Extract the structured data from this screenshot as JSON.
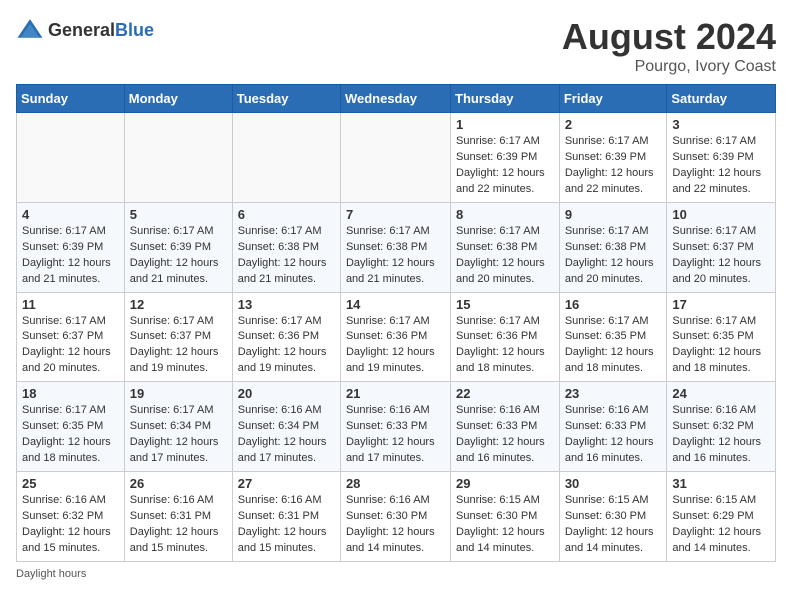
{
  "header": {
    "logo_general": "General",
    "logo_blue": "Blue",
    "month_title": "August 2024",
    "location": "Pourgo, Ivory Coast"
  },
  "days_of_week": [
    "Sunday",
    "Monday",
    "Tuesday",
    "Wednesday",
    "Thursday",
    "Friday",
    "Saturday"
  ],
  "weeks": [
    [
      {
        "day": "",
        "info": ""
      },
      {
        "day": "",
        "info": ""
      },
      {
        "day": "",
        "info": ""
      },
      {
        "day": "",
        "info": ""
      },
      {
        "day": "1",
        "info": "Sunrise: 6:17 AM\nSunset: 6:39 PM\nDaylight: 12 hours\nand 22 minutes."
      },
      {
        "day": "2",
        "info": "Sunrise: 6:17 AM\nSunset: 6:39 PM\nDaylight: 12 hours\nand 22 minutes."
      },
      {
        "day": "3",
        "info": "Sunrise: 6:17 AM\nSunset: 6:39 PM\nDaylight: 12 hours\nand 22 minutes."
      }
    ],
    [
      {
        "day": "4",
        "info": "Sunrise: 6:17 AM\nSunset: 6:39 PM\nDaylight: 12 hours\nand 21 minutes."
      },
      {
        "day": "5",
        "info": "Sunrise: 6:17 AM\nSunset: 6:39 PM\nDaylight: 12 hours\nand 21 minutes."
      },
      {
        "day": "6",
        "info": "Sunrise: 6:17 AM\nSunset: 6:38 PM\nDaylight: 12 hours\nand 21 minutes."
      },
      {
        "day": "7",
        "info": "Sunrise: 6:17 AM\nSunset: 6:38 PM\nDaylight: 12 hours\nand 21 minutes."
      },
      {
        "day": "8",
        "info": "Sunrise: 6:17 AM\nSunset: 6:38 PM\nDaylight: 12 hours\nand 20 minutes."
      },
      {
        "day": "9",
        "info": "Sunrise: 6:17 AM\nSunset: 6:38 PM\nDaylight: 12 hours\nand 20 minutes."
      },
      {
        "day": "10",
        "info": "Sunrise: 6:17 AM\nSunset: 6:37 PM\nDaylight: 12 hours\nand 20 minutes."
      }
    ],
    [
      {
        "day": "11",
        "info": "Sunrise: 6:17 AM\nSunset: 6:37 PM\nDaylight: 12 hours\nand 20 minutes."
      },
      {
        "day": "12",
        "info": "Sunrise: 6:17 AM\nSunset: 6:37 PM\nDaylight: 12 hours\nand 19 minutes."
      },
      {
        "day": "13",
        "info": "Sunrise: 6:17 AM\nSunset: 6:36 PM\nDaylight: 12 hours\nand 19 minutes."
      },
      {
        "day": "14",
        "info": "Sunrise: 6:17 AM\nSunset: 6:36 PM\nDaylight: 12 hours\nand 19 minutes."
      },
      {
        "day": "15",
        "info": "Sunrise: 6:17 AM\nSunset: 6:36 PM\nDaylight: 12 hours\nand 18 minutes."
      },
      {
        "day": "16",
        "info": "Sunrise: 6:17 AM\nSunset: 6:35 PM\nDaylight: 12 hours\nand 18 minutes."
      },
      {
        "day": "17",
        "info": "Sunrise: 6:17 AM\nSunset: 6:35 PM\nDaylight: 12 hours\nand 18 minutes."
      }
    ],
    [
      {
        "day": "18",
        "info": "Sunrise: 6:17 AM\nSunset: 6:35 PM\nDaylight: 12 hours\nand 18 minutes."
      },
      {
        "day": "19",
        "info": "Sunrise: 6:17 AM\nSunset: 6:34 PM\nDaylight: 12 hours\nand 17 minutes."
      },
      {
        "day": "20",
        "info": "Sunrise: 6:16 AM\nSunset: 6:34 PM\nDaylight: 12 hours\nand 17 minutes."
      },
      {
        "day": "21",
        "info": "Sunrise: 6:16 AM\nSunset: 6:33 PM\nDaylight: 12 hours\nand 17 minutes."
      },
      {
        "day": "22",
        "info": "Sunrise: 6:16 AM\nSunset: 6:33 PM\nDaylight: 12 hours\nand 16 minutes."
      },
      {
        "day": "23",
        "info": "Sunrise: 6:16 AM\nSunset: 6:33 PM\nDaylight: 12 hours\nand 16 minutes."
      },
      {
        "day": "24",
        "info": "Sunrise: 6:16 AM\nSunset: 6:32 PM\nDaylight: 12 hours\nand 16 minutes."
      }
    ],
    [
      {
        "day": "25",
        "info": "Sunrise: 6:16 AM\nSunset: 6:32 PM\nDaylight: 12 hours\nand 15 minutes."
      },
      {
        "day": "26",
        "info": "Sunrise: 6:16 AM\nSunset: 6:31 PM\nDaylight: 12 hours\nand 15 minutes."
      },
      {
        "day": "27",
        "info": "Sunrise: 6:16 AM\nSunset: 6:31 PM\nDaylight: 12 hours\nand 15 minutes."
      },
      {
        "day": "28",
        "info": "Sunrise: 6:16 AM\nSunset: 6:30 PM\nDaylight: 12 hours\nand 14 minutes."
      },
      {
        "day": "29",
        "info": "Sunrise: 6:15 AM\nSunset: 6:30 PM\nDaylight: 12 hours\nand 14 minutes."
      },
      {
        "day": "30",
        "info": "Sunrise: 6:15 AM\nSunset: 6:30 PM\nDaylight: 12 hours\nand 14 minutes."
      },
      {
        "day": "31",
        "info": "Sunrise: 6:15 AM\nSunset: 6:29 PM\nDaylight: 12 hours\nand 14 minutes."
      }
    ]
  ],
  "footer": {
    "daylight_label": "Daylight hours"
  }
}
